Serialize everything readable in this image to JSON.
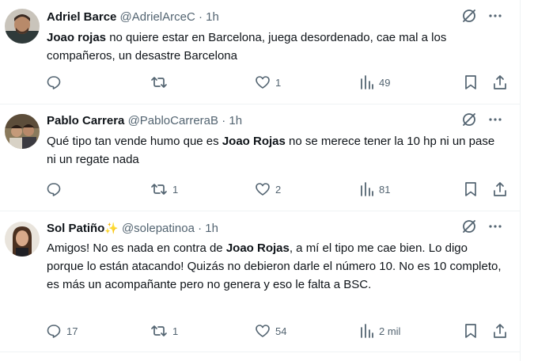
{
  "tweets": [
    {
      "name": "Adriel Barce",
      "handle": "@AdrielArceC",
      "sep": "·",
      "time": "1h",
      "text_bold": "Joao rojas",
      "text_rest": " no quiere estar en Barcelona, juega desordenado, cae mal a los compañeros, un desastre Barcelona",
      "replies": "",
      "retweets": "",
      "likes": "1",
      "views": "49"
    },
    {
      "name": "Pablo Carrera",
      "handle": "@PabloCarreraB",
      "sep": "·",
      "time": "1h",
      "text_pre": "Qué tipo tan vende humo que es ",
      "text_bold": "Joao Rojas",
      "text_post": " no se merece tener la 10 hp ni un pase ni un regate nada",
      "replies": "",
      "retweets": "1",
      "likes": "2",
      "views": "81"
    },
    {
      "name": "Sol Patiño",
      "name_emoji": "✨",
      "handle": "@solepatinoa",
      "sep": "·",
      "time": "1h",
      "text_pre": "Amigos! No es nada en contra de ",
      "text_bold": "Joao Rojas",
      "text_post": ", a mí el tipo me cae bien. Lo digo porque lo están atacando! Quizás no debieron darle el número 10. No es 10 completo, es más un acompañante pero no genera y eso le falta a BSC.",
      "replies": "17",
      "retweets": "1",
      "likes": "54",
      "views": "2 mil"
    }
  ],
  "icons": {
    "reply": "reply-bubble-icon",
    "retweet": "retweet-icon",
    "like": "heart-icon",
    "views": "analytics-bars-icon",
    "bookmark": "bookmark-icon",
    "share": "share-upload-icon",
    "grok": "grok-slash-icon",
    "more": "more-dots-icon"
  },
  "colors": {
    "text": "#0f1419",
    "muted": "#536471",
    "divider": "#eff3f4",
    "sparkle": "#f4b400"
  }
}
